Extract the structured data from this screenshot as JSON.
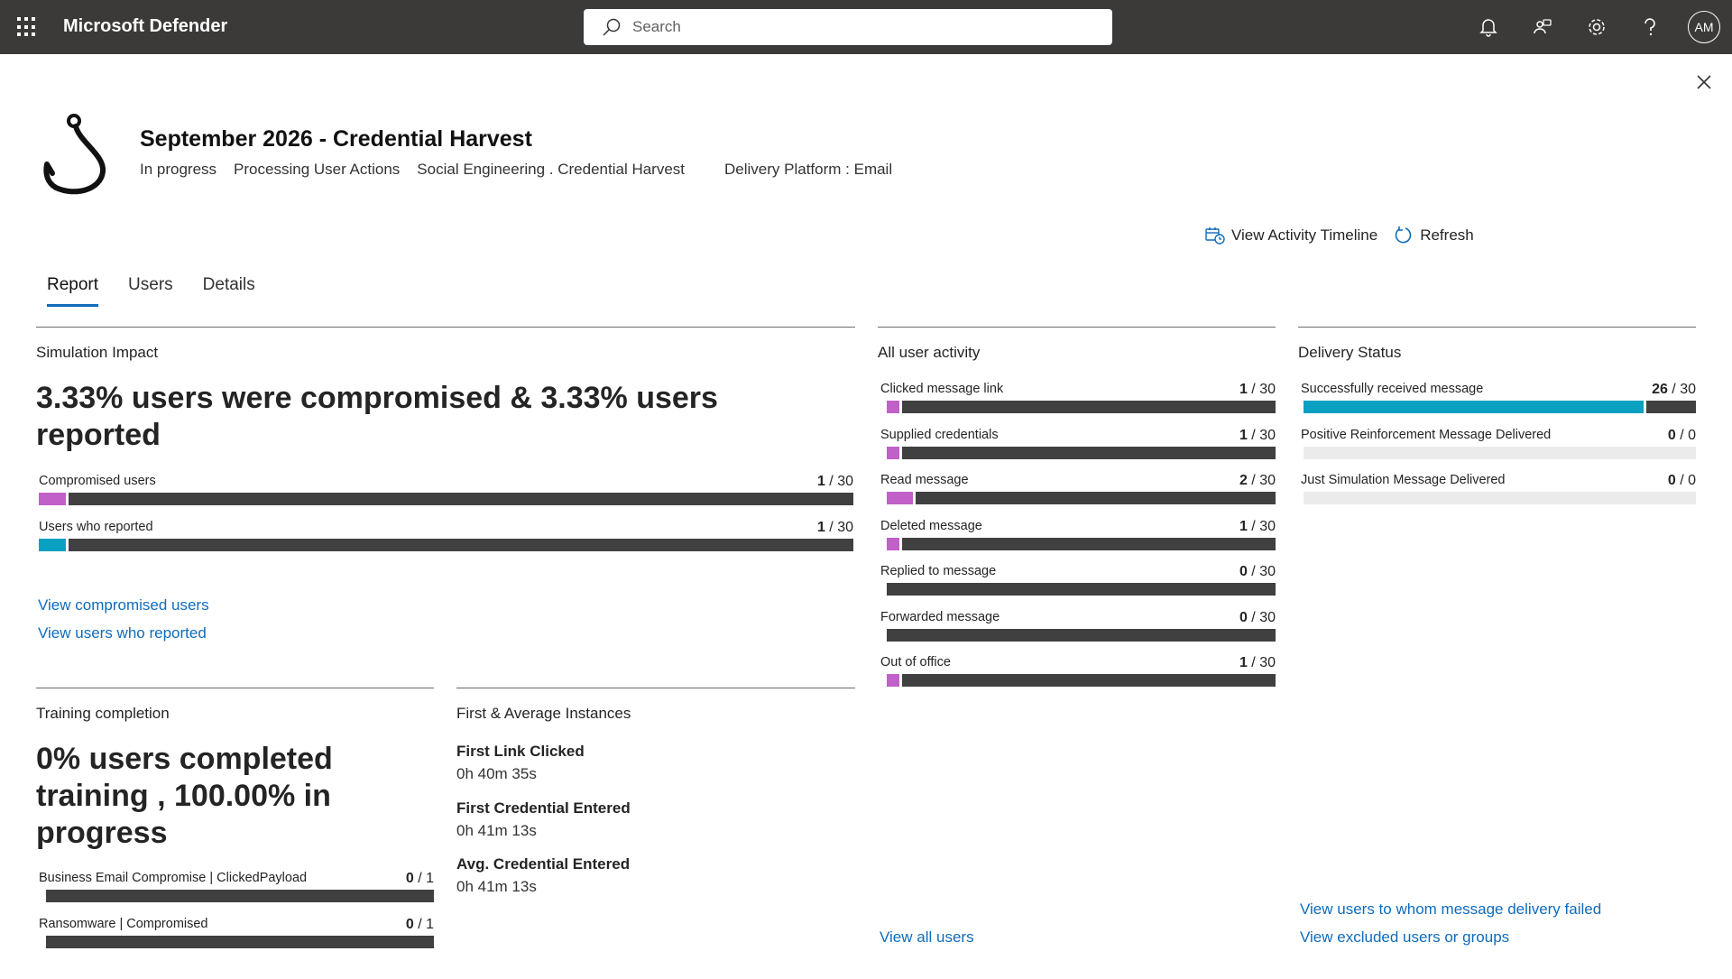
{
  "app": {
    "title": "Microsoft Defender",
    "avatar": "AM"
  },
  "search": {
    "placeholder": "Search"
  },
  "simulation": {
    "title": "September 2026 - Credential Harvest",
    "status": "In progress",
    "stage": "Processing User Actions",
    "technique": "Social Engineering . Credential Harvest",
    "platform": "Delivery Platform : Email"
  },
  "actions": {
    "timeline": "View Activity Timeline",
    "refresh": "Refresh"
  },
  "tabs": [
    "Report",
    "Users",
    "Details"
  ],
  "colors": {
    "accent": "#0f6cbd",
    "compromised": "#c060c8",
    "reported": "#0aa0c2",
    "dark": "#404040",
    "empty": "#ebebeb"
  },
  "impact": {
    "title": "Simulation Impact",
    "headline": "3.33% users were compromised & 3.33% users reported",
    "rows": [
      {
        "label": "Compromised users",
        "value": "1",
        "total": "/ 30",
        "color": "#c060c8",
        "fraction": 0.0333
      },
      {
        "label": "Users who reported",
        "value": "1",
        "total": "/ 30",
        "color": "#0aa0c2",
        "fraction": 0.0333
      }
    ],
    "links": [
      "View compromised users",
      "View users who reported"
    ]
  },
  "activity": {
    "title": "All user activity",
    "rows": [
      {
        "label": "Clicked message link",
        "value": "1",
        "total": "/ 30",
        "fraction": 0.0333
      },
      {
        "label": "Supplied credentials",
        "value": "1",
        "total": "/ 30",
        "fraction": 0.0333
      },
      {
        "label": "Read message",
        "value": "2",
        "total": "/ 30",
        "fraction": 0.0667
      },
      {
        "label": "Deleted message",
        "value": "1",
        "total": "/ 30",
        "fraction": 0.0333
      },
      {
        "label": "Replied to message",
        "value": "0",
        "total": "/ 30",
        "fraction": 0
      },
      {
        "label": "Forwarded message",
        "value": "0",
        "total": "/ 30",
        "fraction": 0
      },
      {
        "label": "Out of office",
        "value": "1",
        "total": "/ 30",
        "fraction": 0.0333
      }
    ],
    "link": "View all users"
  },
  "delivery": {
    "title": "Delivery Status",
    "rows": [
      {
        "label": "Successfully received message",
        "value": "26",
        "total": "/ 30",
        "fraction": 0.8667
      },
      {
        "label": "Positive Reinforcement Message Delivered",
        "value": "0",
        "total": "/ 0",
        "fraction": 0
      },
      {
        "label": "Just Simulation Message Delivered",
        "value": "0",
        "total": "/ 0",
        "fraction": 0
      }
    ],
    "links": [
      "View users to whom message delivery failed",
      "View excluded users or groups"
    ]
  },
  "training": {
    "title": "Training completion",
    "headline": "0% users completed training , 100.00% in progress",
    "rows": [
      {
        "label": "Business Email Compromise | ClickedPayload",
        "value": "0",
        "total": "/ 1",
        "fraction": 0
      },
      {
        "label": "Ransomware | Compromised",
        "value": "0",
        "total": "/ 1",
        "fraction": 0
      }
    ]
  },
  "instances": {
    "title": "First & Average Instances",
    "items": [
      {
        "label": "First Link Clicked",
        "value": "0h 40m 35s"
      },
      {
        "label": "First Credential Entered",
        "value": "0h 41m 13s"
      },
      {
        "label": "Avg. Credential Entered",
        "value": "0h 41m 13s"
      }
    ]
  }
}
